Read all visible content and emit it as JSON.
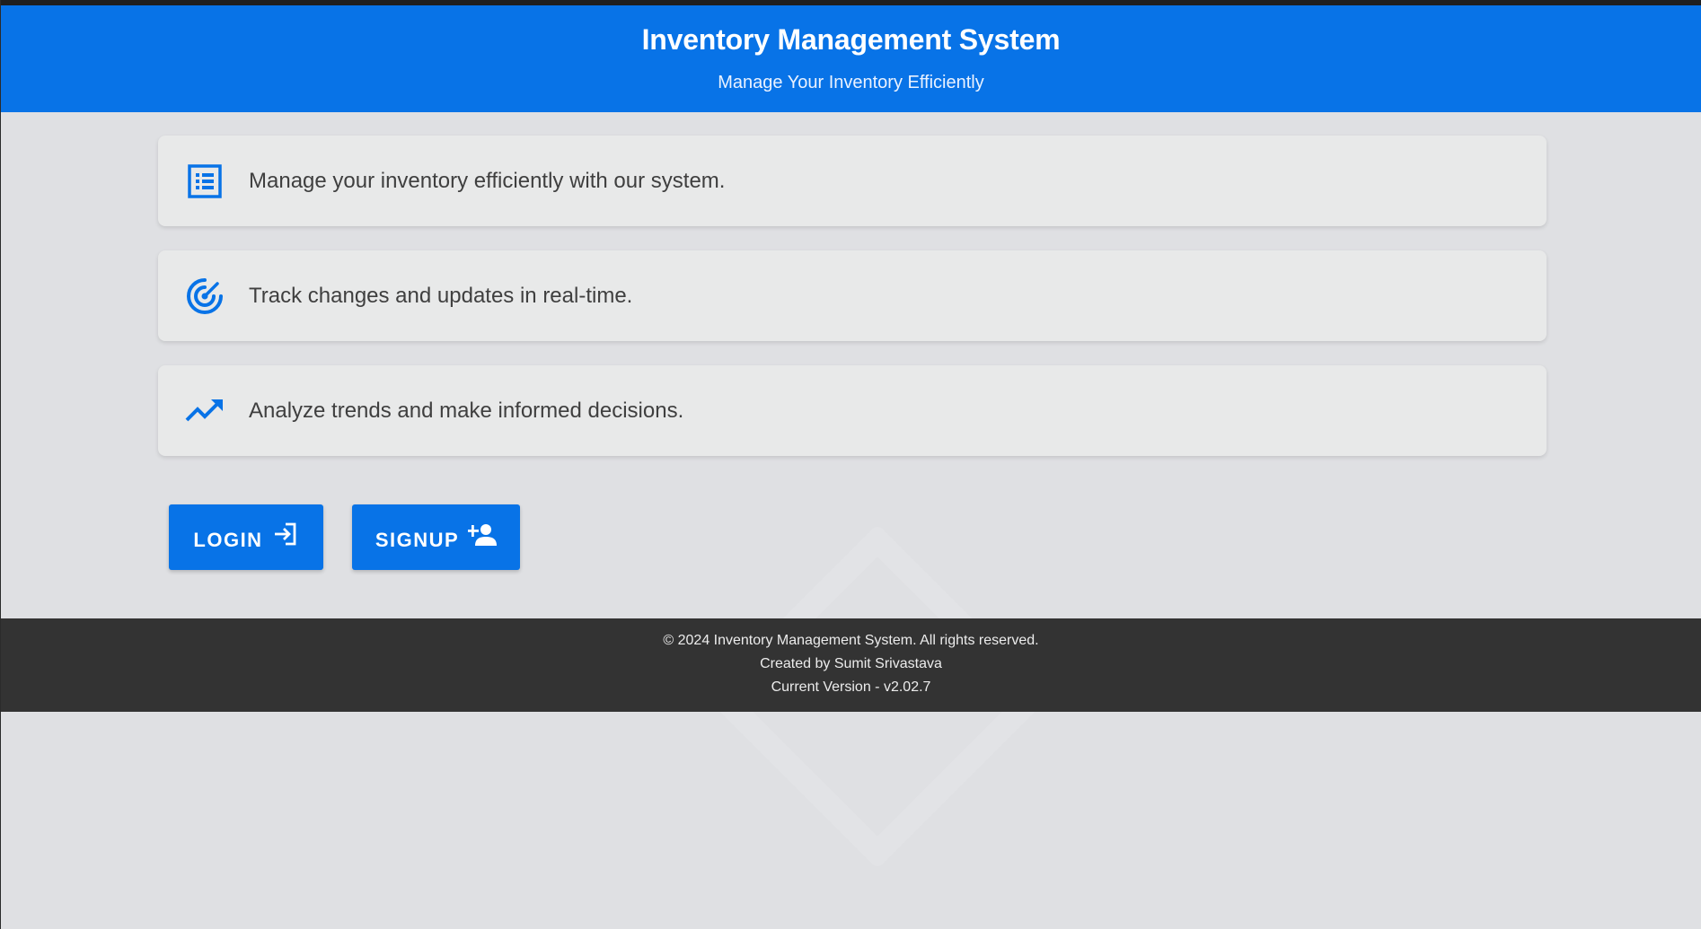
{
  "header": {
    "title": "Inventory Management System",
    "subtitle": "Manage Your Inventory Efficiently"
  },
  "features": [
    {
      "icon": "list-icon",
      "text": "Manage your inventory efficiently with our system."
    },
    {
      "icon": "radar-icon",
      "text": "Track changes and updates in real-time."
    },
    {
      "icon": "trending-up-icon",
      "text": "Analyze trends and make informed decisions."
    }
  ],
  "actions": {
    "login_label": "LOGIN",
    "login_icon": "login-icon",
    "signup_label": "SIGNUP",
    "signup_icon": "person-add-icon"
  },
  "footer": {
    "copyright": "© 2024 Inventory Management System. All rights reserved.",
    "created_by": "Created by Sumit Srivastava",
    "version": "Current Version - v2.02.7"
  },
  "colors": {
    "primary": "#0873e7",
    "footer_bg": "#333333",
    "page_bg": "#dfe0e3",
    "card_bg": "#e8e9e9"
  }
}
